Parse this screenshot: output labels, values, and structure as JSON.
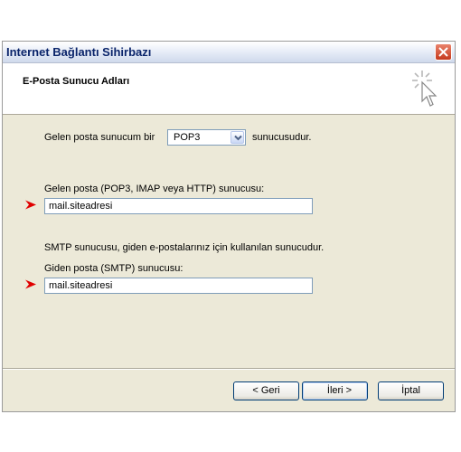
{
  "window": {
    "title": "Internet Bağlantı Sihirbazı"
  },
  "header": {
    "title": "E-Posta Sunucu Adları"
  },
  "incoming_type": {
    "label_before": "Gelen posta sunucum bir",
    "selected": "POP3",
    "label_after": "sunucusudur."
  },
  "incoming_server": {
    "label": "Gelen posta (POP3, IMAP veya HTTP) sunucusu:",
    "value": "mail.siteadresi"
  },
  "smtp": {
    "description": "SMTP sunucusu, giden e-postalarınız için kullanılan sunucudur.",
    "label": "Giden posta (SMTP) sunucusu:",
    "value": "mail.siteadresi"
  },
  "buttons": {
    "back": "< Geri",
    "next": "İleri >",
    "cancel": "İptal"
  },
  "icons": {
    "close": "close-icon",
    "wizard": "wizard-cursor-icon",
    "dropdown": "chevron-down-icon",
    "pointer": "red-arrow-icon"
  },
  "colors": {
    "dialog_bg": "#ece9d8",
    "title_text": "#0a246a",
    "close_button": "#c5391d",
    "pointer_arrow": "#e00000",
    "field_border": "#7f9db9"
  }
}
